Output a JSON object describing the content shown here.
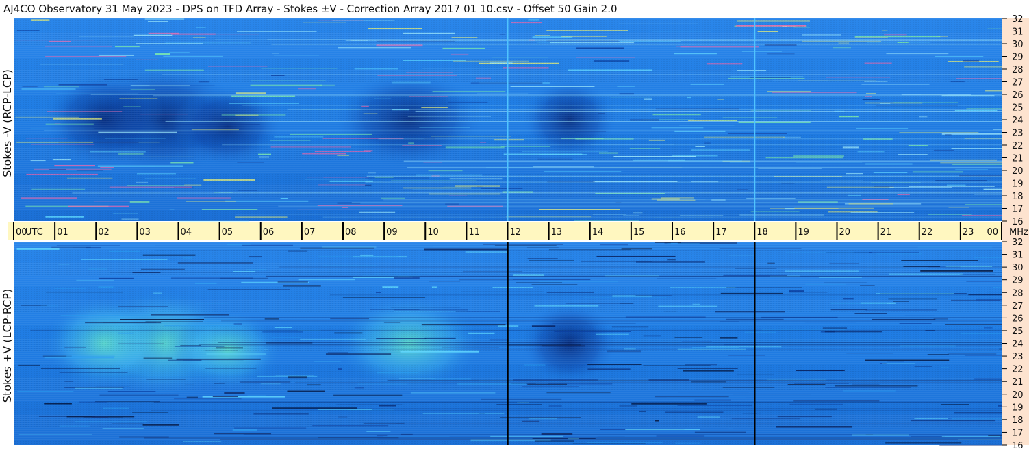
{
  "header": {
    "title": "AJ4CO Observatory  31 May 2023  -  DPS on TFD Array  -  Stokes ±V  -  Correction Array 2017 01 10.csv  -  Offset 50  Gain 2.0"
  },
  "colors": {
    "background": "#ffffff",
    "time_strip": "#fff7c0",
    "freq_strip": "#fde3cf",
    "spectrogram_base": "#1a78e0",
    "spectrogram_dark": "#0a3a9a",
    "spectrogram_light": "#29b8ff",
    "marker_top": "#4fc3ff",
    "marker_bottom": "#000000"
  },
  "chart_data": {
    "type": "heatmap",
    "title": "AJ4CO Observatory  31 May 2023  -  DPS on TFD Array  -  Stokes ±V  -  Correction Array 2017 01 10.csv  -  Offset 50  Gain 2.0",
    "time_axis": {
      "ticks": [
        "00",
        "01",
        "02",
        "03",
        "04",
        "05",
        "06",
        "07",
        "08",
        "09",
        "10",
        "11",
        "12",
        "13",
        "14",
        "15",
        "16",
        "17",
        "18",
        "19",
        "20",
        "21",
        "22",
        "23",
        "00"
      ],
      "unit_label": "UTC",
      "range_hours": [
        0,
        24
      ]
    },
    "freq_axis": {
      "ticks": [
        "16",
        "17",
        "18",
        "19",
        "20",
        "21",
        "22",
        "23",
        "24",
        "25",
        "26",
        "27",
        "28",
        "29",
        "30",
        "31",
        "32"
      ],
      "unit_label": "MHz",
      "range_mhz": [
        16,
        32
      ]
    },
    "panels": [
      {
        "ylabel": "Stokes -V (RCP-LCP)"
      },
      {
        "ylabel": "Stokes +V (LCP-RCP)"
      }
    ],
    "markers_utc_hours": [
      12,
      18
    ]
  }
}
